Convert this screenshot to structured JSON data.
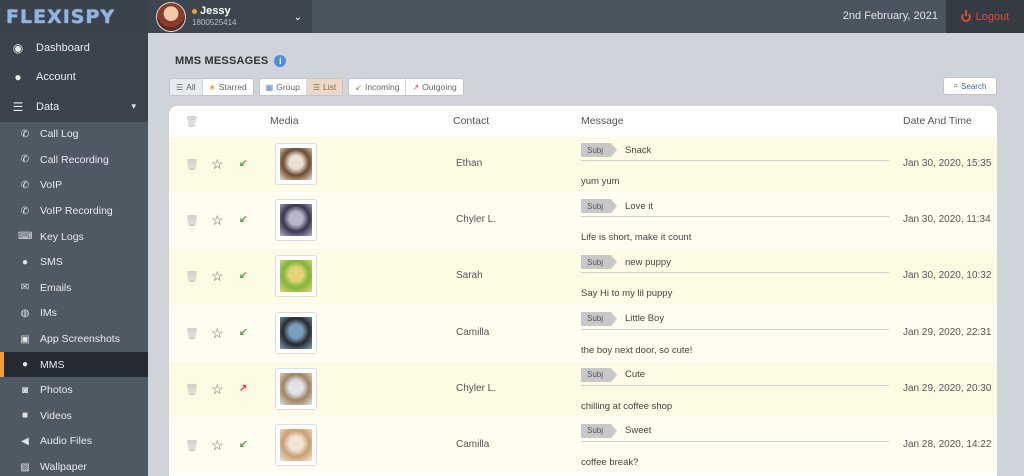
{
  "app": {
    "logo": "FLEXISPY",
    "date": "2nd February, 2021",
    "logout_label": "Logout"
  },
  "user": {
    "name": "Jessy",
    "phone": "1800525414"
  },
  "sidebar": {
    "top": [
      {
        "label": "Dashboard",
        "icon": "dashboard-icon"
      },
      {
        "label": "Account",
        "icon": "user-icon"
      },
      {
        "label": "Data",
        "icon": "database-icon"
      }
    ],
    "sub": [
      {
        "label": "Call Log",
        "icon": "phone-icon"
      },
      {
        "label": "Call Recording",
        "icon": "phone-recording-icon"
      },
      {
        "label": "VoIP",
        "icon": "voip-icon"
      },
      {
        "label": "VoIP Recording",
        "icon": "voip-recording-icon"
      },
      {
        "label": "Key Logs",
        "icon": "keyboard-icon"
      },
      {
        "label": "SMS",
        "icon": "chat-bubble-icon"
      },
      {
        "label": "Emails",
        "icon": "envelope-icon"
      },
      {
        "label": "IMs",
        "icon": "im-icon"
      },
      {
        "label": "App Screenshots",
        "icon": "screenshot-icon"
      },
      {
        "label": "MMS",
        "icon": "mms-icon"
      },
      {
        "label": "Photos",
        "icon": "camera-icon"
      },
      {
        "label": "Videos",
        "icon": "video-icon"
      },
      {
        "label": "Audio Files",
        "icon": "speaker-icon"
      },
      {
        "label": "Wallpaper",
        "icon": "image-icon"
      }
    ],
    "active": "MMS"
  },
  "page": {
    "title": "MMS MESSAGES"
  },
  "filters": {
    "all": "All",
    "starred": "Starred",
    "group": "Group",
    "list": "List",
    "incoming": "Incoming",
    "outgoing": "Outgoing",
    "search": "Search"
  },
  "table": {
    "headers": {
      "media": "Media",
      "contact": "Contact",
      "message": "Message",
      "date": "Date And Time"
    },
    "subj_label": "Subj",
    "rows": [
      {
        "direction": "in",
        "contact": "Ethan",
        "subject": "Snack",
        "message": "yum yum",
        "datetime": "Jan 30, 2020, 15:35",
        "thumb_colors": [
          "#6b4a30",
          "#e9e2d3"
        ]
      },
      {
        "direction": "in",
        "contact": "Chyler L.",
        "subject": "Love it",
        "message": "Life is short, make it count",
        "datetime": "Jan 30, 2020, 11:34",
        "thumb_colors": [
          "#3a3550",
          "#b9b4c8"
        ]
      },
      {
        "direction": "in",
        "contact": "Sarah",
        "subject": "new puppy",
        "message": "Say Hi to my lil puppy",
        "datetime": "Jan 30, 2020, 10:32",
        "thumb_colors": [
          "#7bb83a",
          "#e7d47a"
        ]
      },
      {
        "direction": "in",
        "contact": "Camilla",
        "subject": "Little Boy",
        "message": "the boy next door, so cute!",
        "datetime": "Jan 29, 2020, 22:31",
        "thumb_colors": [
          "#2a2a2a",
          "#7aa0c0"
        ]
      },
      {
        "direction": "out",
        "contact": "Chyler L.",
        "subject": "Cute",
        "message": "chilling at coffee shop",
        "datetime": "Jan 29, 2020, 20:30",
        "thumb_colors": [
          "#a08460",
          "#e0e4ea"
        ]
      },
      {
        "direction": "in",
        "contact": "Camilla",
        "subject": "Sweet",
        "message": "coffee break?",
        "datetime": "Jan 28, 2020, 14:22",
        "thumb_colors": [
          "#c9a070",
          "#f1e6d6"
        ]
      }
    ]
  }
}
